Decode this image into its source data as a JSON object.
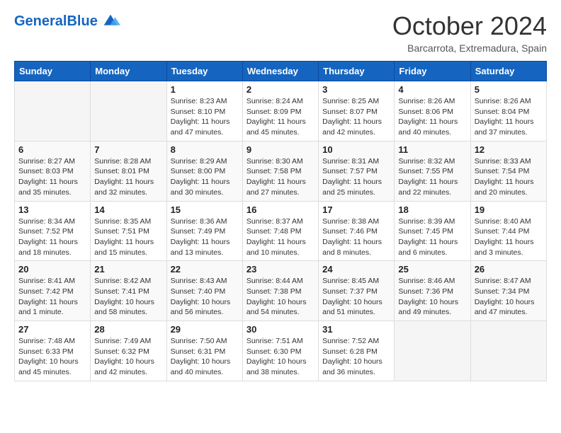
{
  "header": {
    "logo_general": "General",
    "logo_blue": "Blue",
    "month_title": "October 2024",
    "location": "Barcarrota, Extremadura, Spain"
  },
  "weekdays": [
    "Sunday",
    "Monday",
    "Tuesday",
    "Wednesday",
    "Thursday",
    "Friday",
    "Saturday"
  ],
  "weeks": [
    [
      {
        "day": "",
        "info": ""
      },
      {
        "day": "",
        "info": ""
      },
      {
        "day": "1",
        "info": "Sunrise: 8:23 AM\nSunset: 8:10 PM\nDaylight: 11 hours and 47 minutes."
      },
      {
        "day": "2",
        "info": "Sunrise: 8:24 AM\nSunset: 8:09 PM\nDaylight: 11 hours and 45 minutes."
      },
      {
        "day": "3",
        "info": "Sunrise: 8:25 AM\nSunset: 8:07 PM\nDaylight: 11 hours and 42 minutes."
      },
      {
        "day": "4",
        "info": "Sunrise: 8:26 AM\nSunset: 8:06 PM\nDaylight: 11 hours and 40 minutes."
      },
      {
        "day": "5",
        "info": "Sunrise: 8:26 AM\nSunset: 8:04 PM\nDaylight: 11 hours and 37 minutes."
      }
    ],
    [
      {
        "day": "6",
        "info": "Sunrise: 8:27 AM\nSunset: 8:03 PM\nDaylight: 11 hours and 35 minutes."
      },
      {
        "day": "7",
        "info": "Sunrise: 8:28 AM\nSunset: 8:01 PM\nDaylight: 11 hours and 32 minutes."
      },
      {
        "day": "8",
        "info": "Sunrise: 8:29 AM\nSunset: 8:00 PM\nDaylight: 11 hours and 30 minutes."
      },
      {
        "day": "9",
        "info": "Sunrise: 8:30 AM\nSunset: 7:58 PM\nDaylight: 11 hours and 27 minutes."
      },
      {
        "day": "10",
        "info": "Sunrise: 8:31 AM\nSunset: 7:57 PM\nDaylight: 11 hours and 25 minutes."
      },
      {
        "day": "11",
        "info": "Sunrise: 8:32 AM\nSunset: 7:55 PM\nDaylight: 11 hours and 22 minutes."
      },
      {
        "day": "12",
        "info": "Sunrise: 8:33 AM\nSunset: 7:54 PM\nDaylight: 11 hours and 20 minutes."
      }
    ],
    [
      {
        "day": "13",
        "info": "Sunrise: 8:34 AM\nSunset: 7:52 PM\nDaylight: 11 hours and 18 minutes."
      },
      {
        "day": "14",
        "info": "Sunrise: 8:35 AM\nSunset: 7:51 PM\nDaylight: 11 hours and 15 minutes."
      },
      {
        "day": "15",
        "info": "Sunrise: 8:36 AM\nSunset: 7:49 PM\nDaylight: 11 hours and 13 minutes."
      },
      {
        "day": "16",
        "info": "Sunrise: 8:37 AM\nSunset: 7:48 PM\nDaylight: 11 hours and 10 minutes."
      },
      {
        "day": "17",
        "info": "Sunrise: 8:38 AM\nSunset: 7:46 PM\nDaylight: 11 hours and 8 minutes."
      },
      {
        "day": "18",
        "info": "Sunrise: 8:39 AM\nSunset: 7:45 PM\nDaylight: 11 hours and 6 minutes."
      },
      {
        "day": "19",
        "info": "Sunrise: 8:40 AM\nSunset: 7:44 PM\nDaylight: 11 hours and 3 minutes."
      }
    ],
    [
      {
        "day": "20",
        "info": "Sunrise: 8:41 AM\nSunset: 7:42 PM\nDaylight: 11 hours and 1 minute."
      },
      {
        "day": "21",
        "info": "Sunrise: 8:42 AM\nSunset: 7:41 PM\nDaylight: 10 hours and 58 minutes."
      },
      {
        "day": "22",
        "info": "Sunrise: 8:43 AM\nSunset: 7:40 PM\nDaylight: 10 hours and 56 minutes."
      },
      {
        "day": "23",
        "info": "Sunrise: 8:44 AM\nSunset: 7:38 PM\nDaylight: 10 hours and 54 minutes."
      },
      {
        "day": "24",
        "info": "Sunrise: 8:45 AM\nSunset: 7:37 PM\nDaylight: 10 hours and 51 minutes."
      },
      {
        "day": "25",
        "info": "Sunrise: 8:46 AM\nSunset: 7:36 PM\nDaylight: 10 hours and 49 minutes."
      },
      {
        "day": "26",
        "info": "Sunrise: 8:47 AM\nSunset: 7:34 PM\nDaylight: 10 hours and 47 minutes."
      }
    ],
    [
      {
        "day": "27",
        "info": "Sunrise: 7:48 AM\nSunset: 6:33 PM\nDaylight: 10 hours and 45 minutes."
      },
      {
        "day": "28",
        "info": "Sunrise: 7:49 AM\nSunset: 6:32 PM\nDaylight: 10 hours and 42 minutes."
      },
      {
        "day": "29",
        "info": "Sunrise: 7:50 AM\nSunset: 6:31 PM\nDaylight: 10 hours and 40 minutes."
      },
      {
        "day": "30",
        "info": "Sunrise: 7:51 AM\nSunset: 6:30 PM\nDaylight: 10 hours and 38 minutes."
      },
      {
        "day": "31",
        "info": "Sunrise: 7:52 AM\nSunset: 6:28 PM\nDaylight: 10 hours and 36 minutes."
      },
      {
        "day": "",
        "info": ""
      },
      {
        "day": "",
        "info": ""
      }
    ]
  ]
}
